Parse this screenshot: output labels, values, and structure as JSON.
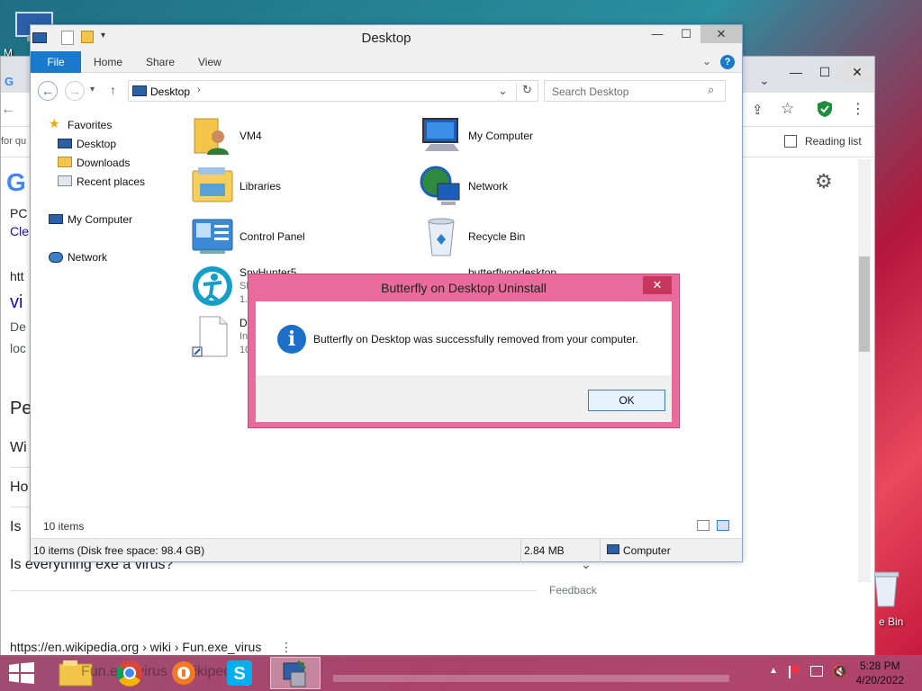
{
  "desktop": {
    "partial_label_topleft": "M",
    "partial_label_right": "e Bin"
  },
  "chrome": {
    "reading_list": "Reading list",
    "page": {
      "partial_1": "PC",
      "partial_2": "Cle",
      "partial_3": "htt",
      "partial_4": "vi",
      "partial_5": "De",
      "partial_6": "loc",
      "partial_7": "Pe",
      "partial_8": "Wi",
      "partial_9": "Ho",
      "partial_10": "Is",
      "question": "Is everything exe a virus?",
      "feedback": "Feedback",
      "url_line": "https://en.wikipedia.org › wiki › Fun.exe_virus",
      "left_partial": "for qu"
    }
  },
  "explorer": {
    "title": "Desktop",
    "tabs": [
      "File",
      "Home",
      "Share",
      "View"
    ],
    "address": "Desktop",
    "search_placeholder": "Search Desktop",
    "nav": {
      "favorites": "Favorites",
      "desktop": "Desktop",
      "downloads": "Downloads",
      "recent": "Recent places",
      "my_computer": "My Computer",
      "network": "Network"
    },
    "items": [
      {
        "name": "VM4"
      },
      {
        "name": "My Computer"
      },
      {
        "name": "Libraries"
      },
      {
        "name": "Network"
      },
      {
        "name": "Control Panel"
      },
      {
        "name": "Recycle Bin"
      },
      {
        "name": "SpyHunter5",
        "sub1": "Sh",
        "sub2": "1."
      },
      {
        "name": "butterflyondesktop"
      },
      {
        "name": "Da",
        "sub1": "In",
        "sub2": "10"
      }
    ],
    "item_count": "10 items",
    "status_left": "10 items (Disk free space: 98.4 GB)",
    "status_size": "2.84 MB",
    "status_location": "Computer"
  },
  "dialog": {
    "title": "Butterfly on Desktop Uninstall",
    "message": "Butterfly on Desktop was successfully removed from your computer.",
    "ok": "OK",
    "close": "✕"
  },
  "taskbar": {
    "time": "5:28 PM",
    "date": "4/20/2022",
    "behind_text": "Fun.exe virus - Wikipedia"
  }
}
